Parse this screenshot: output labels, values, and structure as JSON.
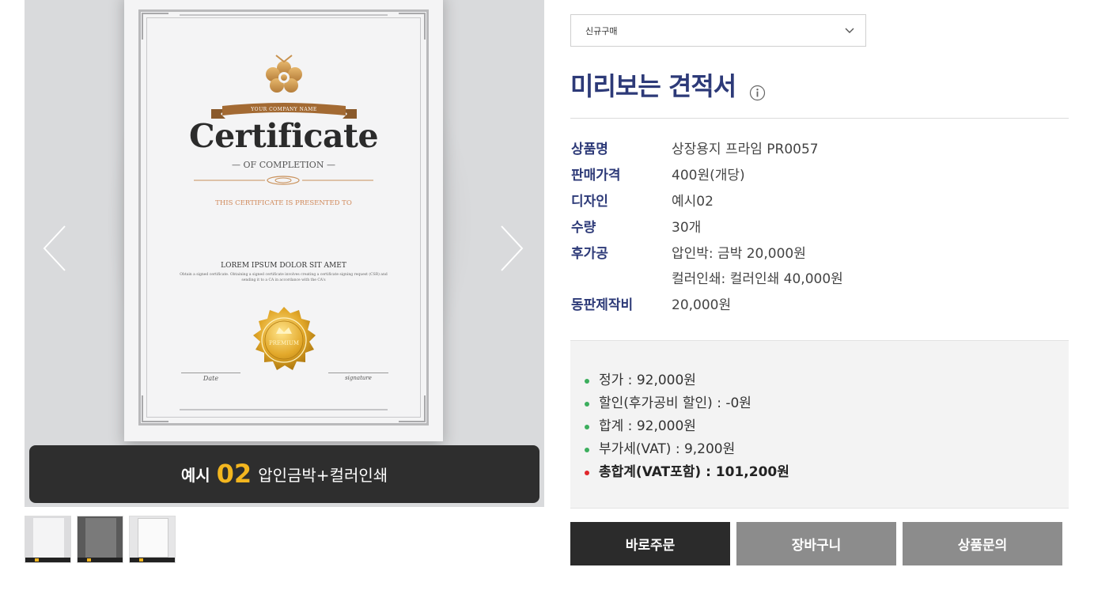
{
  "gallery": {
    "certificate": {
      "ribbon": "YOUR COMPANY NAME",
      "title": "Certificate",
      "subtitle": "— OF COMPLETION —",
      "presented": "THIS CERTIFICATE IS PRESENTED TO",
      "lorem": "LOREM IPSUM DOLOR SIT AMET",
      "description": "Obtain a signed certificate. Obtaining a signed certificate involves creating a certificate signing request (CSR) and sending it to a CA in accordance with the CA's",
      "seal": "PREMIUM",
      "date_label": "Date",
      "signature_label": "signature"
    },
    "caption": {
      "prefix": "예시",
      "number": "02",
      "text": "압인금박+컬러인쇄"
    },
    "thumbnails": [
      "thumb-1",
      "thumb-2",
      "thumb-3"
    ]
  },
  "options": {
    "select_value": "신규구매"
  },
  "estimate": {
    "title": "미리보는 견적서",
    "rows": [
      {
        "label": "상품명",
        "value": "상장용지 프라임 PR0057"
      },
      {
        "label": "판매가격",
        "value": "400원(개당)"
      },
      {
        "label": "디자인",
        "value": "예시02"
      },
      {
        "label": "수량",
        "value": "30개"
      },
      {
        "label": "후가공",
        "value": "압인박: 금박 20,000원"
      },
      {
        "label": "",
        "value": "컬러인쇄: 컬러인쇄 40,000원"
      },
      {
        "label": "동판제작비",
        "value": "20,000원"
      }
    ]
  },
  "summary": {
    "list_price": "정가 : 92,000원",
    "discount": "할인(후가공비 할인) : -0원",
    "subtotal": "합계 : 92,000원",
    "vat": "부가세(VAT) : 9,200원",
    "total": "총합계(VAT포함) : 101,200원"
  },
  "buttons": {
    "order": "바로주문",
    "cart": "장바구니",
    "inquiry": "상품문의"
  },
  "colors": {
    "accent": "#2d3a78",
    "gold": "#f3b61f",
    "bullet_green": "#3cae5d",
    "bullet_red": "#e0262b"
  }
}
